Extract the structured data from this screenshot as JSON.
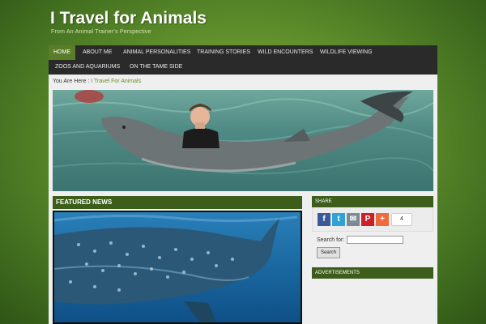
{
  "site": {
    "title": "I Travel for Animals",
    "tagline": "From An Animal Trainer's Perspective"
  },
  "nav": {
    "items": [
      {
        "label": "HOME",
        "active": true
      },
      {
        "label": "ABOUT ME"
      },
      {
        "label": "ANIMAL PERSONALITIES"
      },
      {
        "label": "TRAINING STORIES"
      },
      {
        "label": "WILD ENCOUNTERS"
      },
      {
        "label": "WILDLIFE VIEWING"
      },
      {
        "label": "ZOOS AND AQUARIUMS"
      },
      {
        "label": "ON THE TAME SIDE"
      }
    ]
  },
  "breadcrumb": {
    "prefix": "You Are Here :",
    "current": "I Travel For Animals"
  },
  "hero": {
    "image": "woman-with-dolphin-in-pool"
  },
  "featured": {
    "title": "FEATURED NEWS",
    "image": "whale-shark-underwater"
  },
  "sidebar": {
    "share": {
      "title": "SHARE",
      "buttons": [
        {
          "icon": "facebook-icon",
          "glyph": "f",
          "color": "#3b5998"
        },
        {
          "icon": "twitter-icon",
          "glyph": "t",
          "color": "#2fa3d8"
        },
        {
          "icon": "email-icon",
          "glyph": "✉",
          "color": "#7d8a96"
        },
        {
          "icon": "pinterest-icon",
          "glyph": "P",
          "color": "#cb2027"
        },
        {
          "icon": "addthis-plus-icon",
          "glyph": "+",
          "color": "#f06b3c"
        }
      ],
      "count": "4"
    },
    "search": {
      "label": "Search for:",
      "value": "",
      "button_label": "Search"
    },
    "ads": {
      "title": "ADVERTISEMENTS"
    }
  },
  "colors": {
    "header_green": "#5f8f2c",
    "widget_title": "#3d5e1b",
    "nav_bg": "#2a2a2a",
    "nav_active": "#5a7d2a",
    "link_green": "#6b8e23"
  }
}
